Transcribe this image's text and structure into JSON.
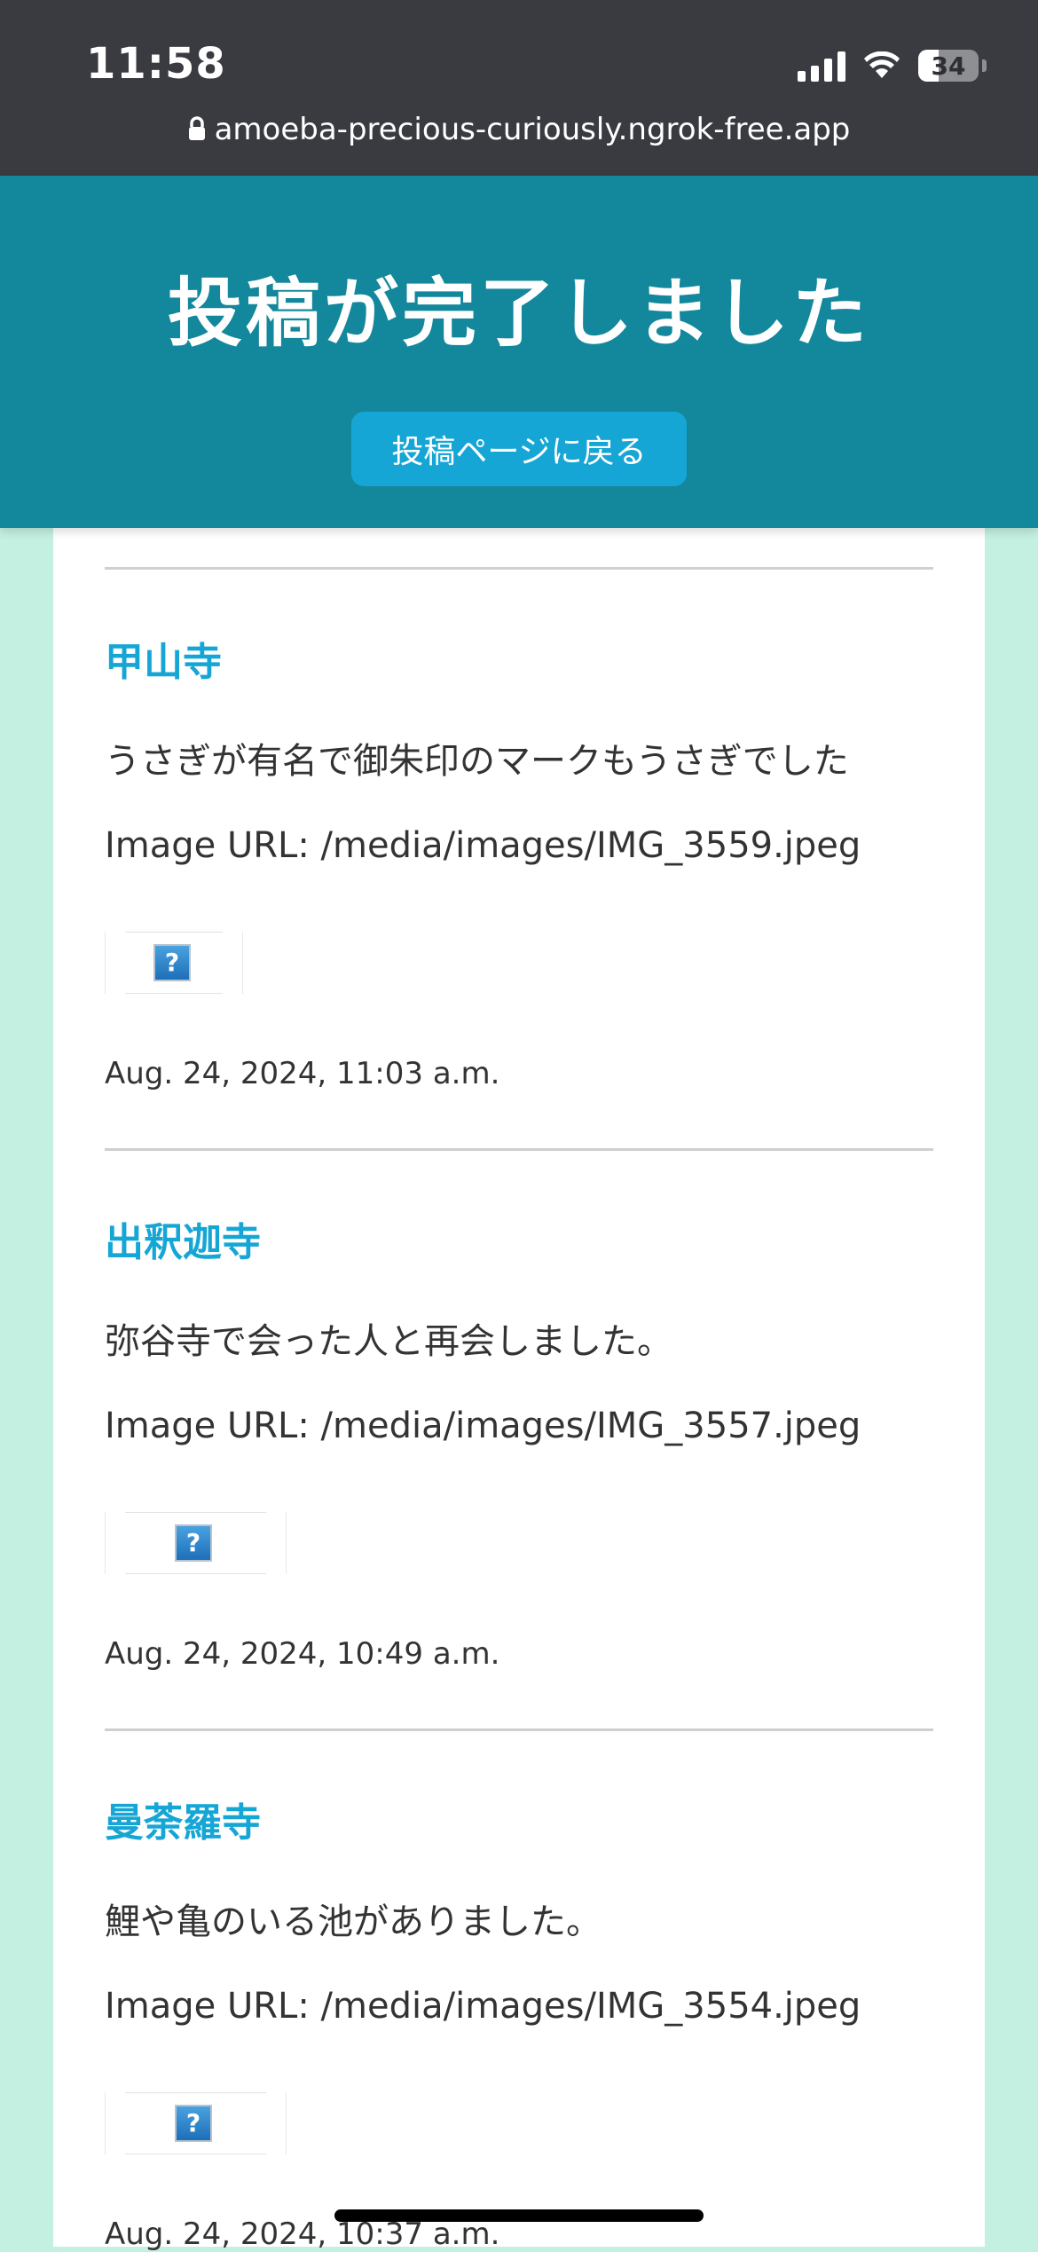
{
  "status_bar": {
    "time": "11:58",
    "battery": "34"
  },
  "browser": {
    "url": "amoeba-precious-curiously.ngrok-free.app"
  },
  "header": {
    "title": "投稿が完了しました",
    "back_button": "投稿ページに戻る"
  },
  "posts": [
    {
      "title": "甲山寺",
      "body": "うさぎが有名で御朱印のマークもうさぎでした",
      "image_url": "Image URL: /media/images/IMG_3559.jpeg",
      "date": "Aug. 24, 2024, 11:03 a.m."
    },
    {
      "title": "出釈迦寺",
      "body": "弥谷寺で会った人と再会しました。",
      "image_url": "Image URL: /media/images/IMG_3557.jpeg",
      "date": "Aug. 24, 2024, 10:49 a.m."
    },
    {
      "title": "曼荼羅寺",
      "body": "鯉や亀のいる池がありました。",
      "image_url": "Image URL: /media/images/IMG_3554.jpeg",
      "date": "Aug. 24, 2024, 10:37 a.m."
    }
  ],
  "broken_image_glyph": "?"
}
